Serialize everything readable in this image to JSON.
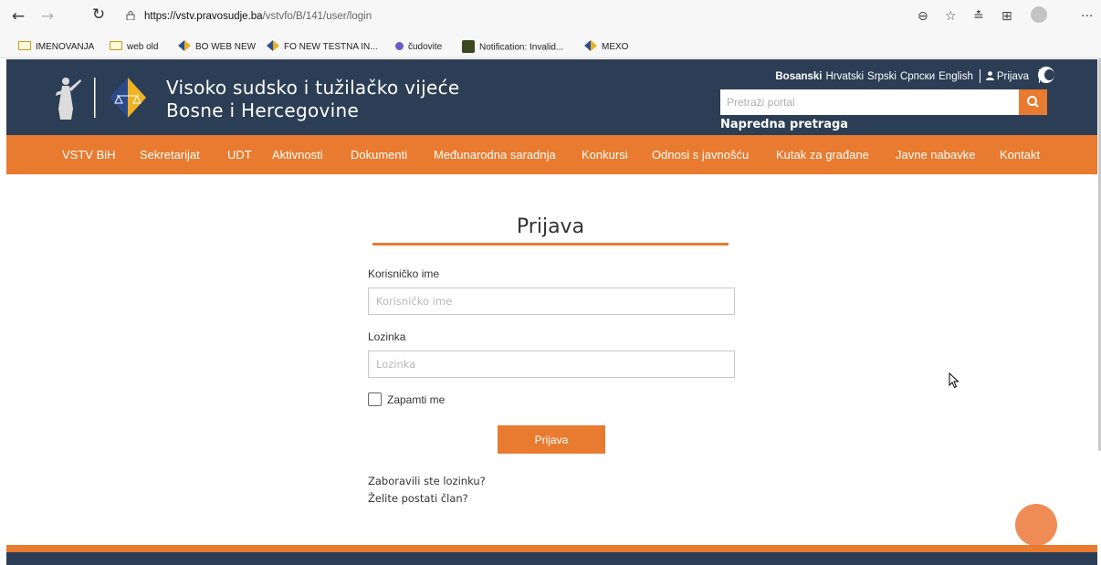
{
  "browser": {
    "url_host": "https://vstv.pravosudje.ba",
    "url_path": "/vstvfo/B/141/user/login",
    "bookmarks": [
      {
        "label": "IMENOVANJA",
        "icon": "folder-icon"
      },
      {
        "label": "web old",
        "icon": "folder-icon"
      },
      {
        "label": "BO WEB NEW",
        "icon": "site-logo-icon"
      },
      {
        "label": "FO NEW TESTNA IN...",
        "icon": "site-logo-icon"
      },
      {
        "label": "čudovite",
        "icon": "dot-icon"
      },
      {
        "label": "Notification: Invalid...",
        "icon": "notification-icon"
      },
      {
        "label": "MEXO",
        "icon": "site-logo-icon"
      }
    ]
  },
  "header": {
    "title_line1": "Visoko sudsko i tužilačko vijeće",
    "title_line2": "Bosne i Hercegovine",
    "languages": [
      "Bosanski",
      "Hrvatski",
      "Srpski",
      "Српски",
      "English"
    ],
    "active_language": "Bosanski",
    "login_link": "Prijava",
    "search_placeholder": "Pretraži portal",
    "advanced_search": "Napredna pretraga",
    "accent": "#e87b2f",
    "header_bg": "#2c3e55"
  },
  "nav": {
    "items": [
      "VSTV BiH",
      "Sekretarijat",
      "UDT",
      "Aktivnosti",
      "Dokumenti",
      "Međunarodna saradnja",
      "Konkursi",
      "Odnosi s javnošću",
      "Kutak za građane",
      "Javne nabavke",
      "Kontakt"
    ]
  },
  "login": {
    "title": "Prijava",
    "username_label": "Korisničko ime",
    "username_placeholder": "Korisničko ime",
    "password_label": "Lozinka",
    "password_placeholder": "Lozinka",
    "remember_label": "Zapamti me",
    "submit_label": "Prijava",
    "forgot_link": "Zaboravili ste lozinku?",
    "register_link": "Želite postati član?"
  }
}
